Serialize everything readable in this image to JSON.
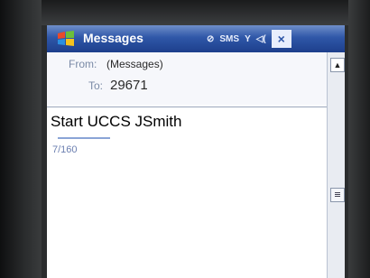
{
  "window": {
    "title": "Messages",
    "close_label": "×",
    "start_icon": "windows-flag-icon"
  },
  "status_icons": [
    {
      "name": "signal-off-icon",
      "label": "⊘"
    },
    {
      "name": "sms-icon",
      "label": "SMS"
    },
    {
      "name": "antenna-icon",
      "label": "Y"
    },
    {
      "name": "speaker-icon",
      "label": "◁("
    }
  ],
  "header": {
    "from_label": "From:",
    "from_value": "(Messages)",
    "to_label": "To:",
    "to_value": "29671"
  },
  "compose": {
    "body": "Start  UCCS JSmith",
    "counter": "7/160"
  },
  "scrollbar": {
    "up_icon": "▲"
  },
  "colors": {
    "titlebar": "#2f57a8",
    "accent": "#8aa4d6"
  }
}
